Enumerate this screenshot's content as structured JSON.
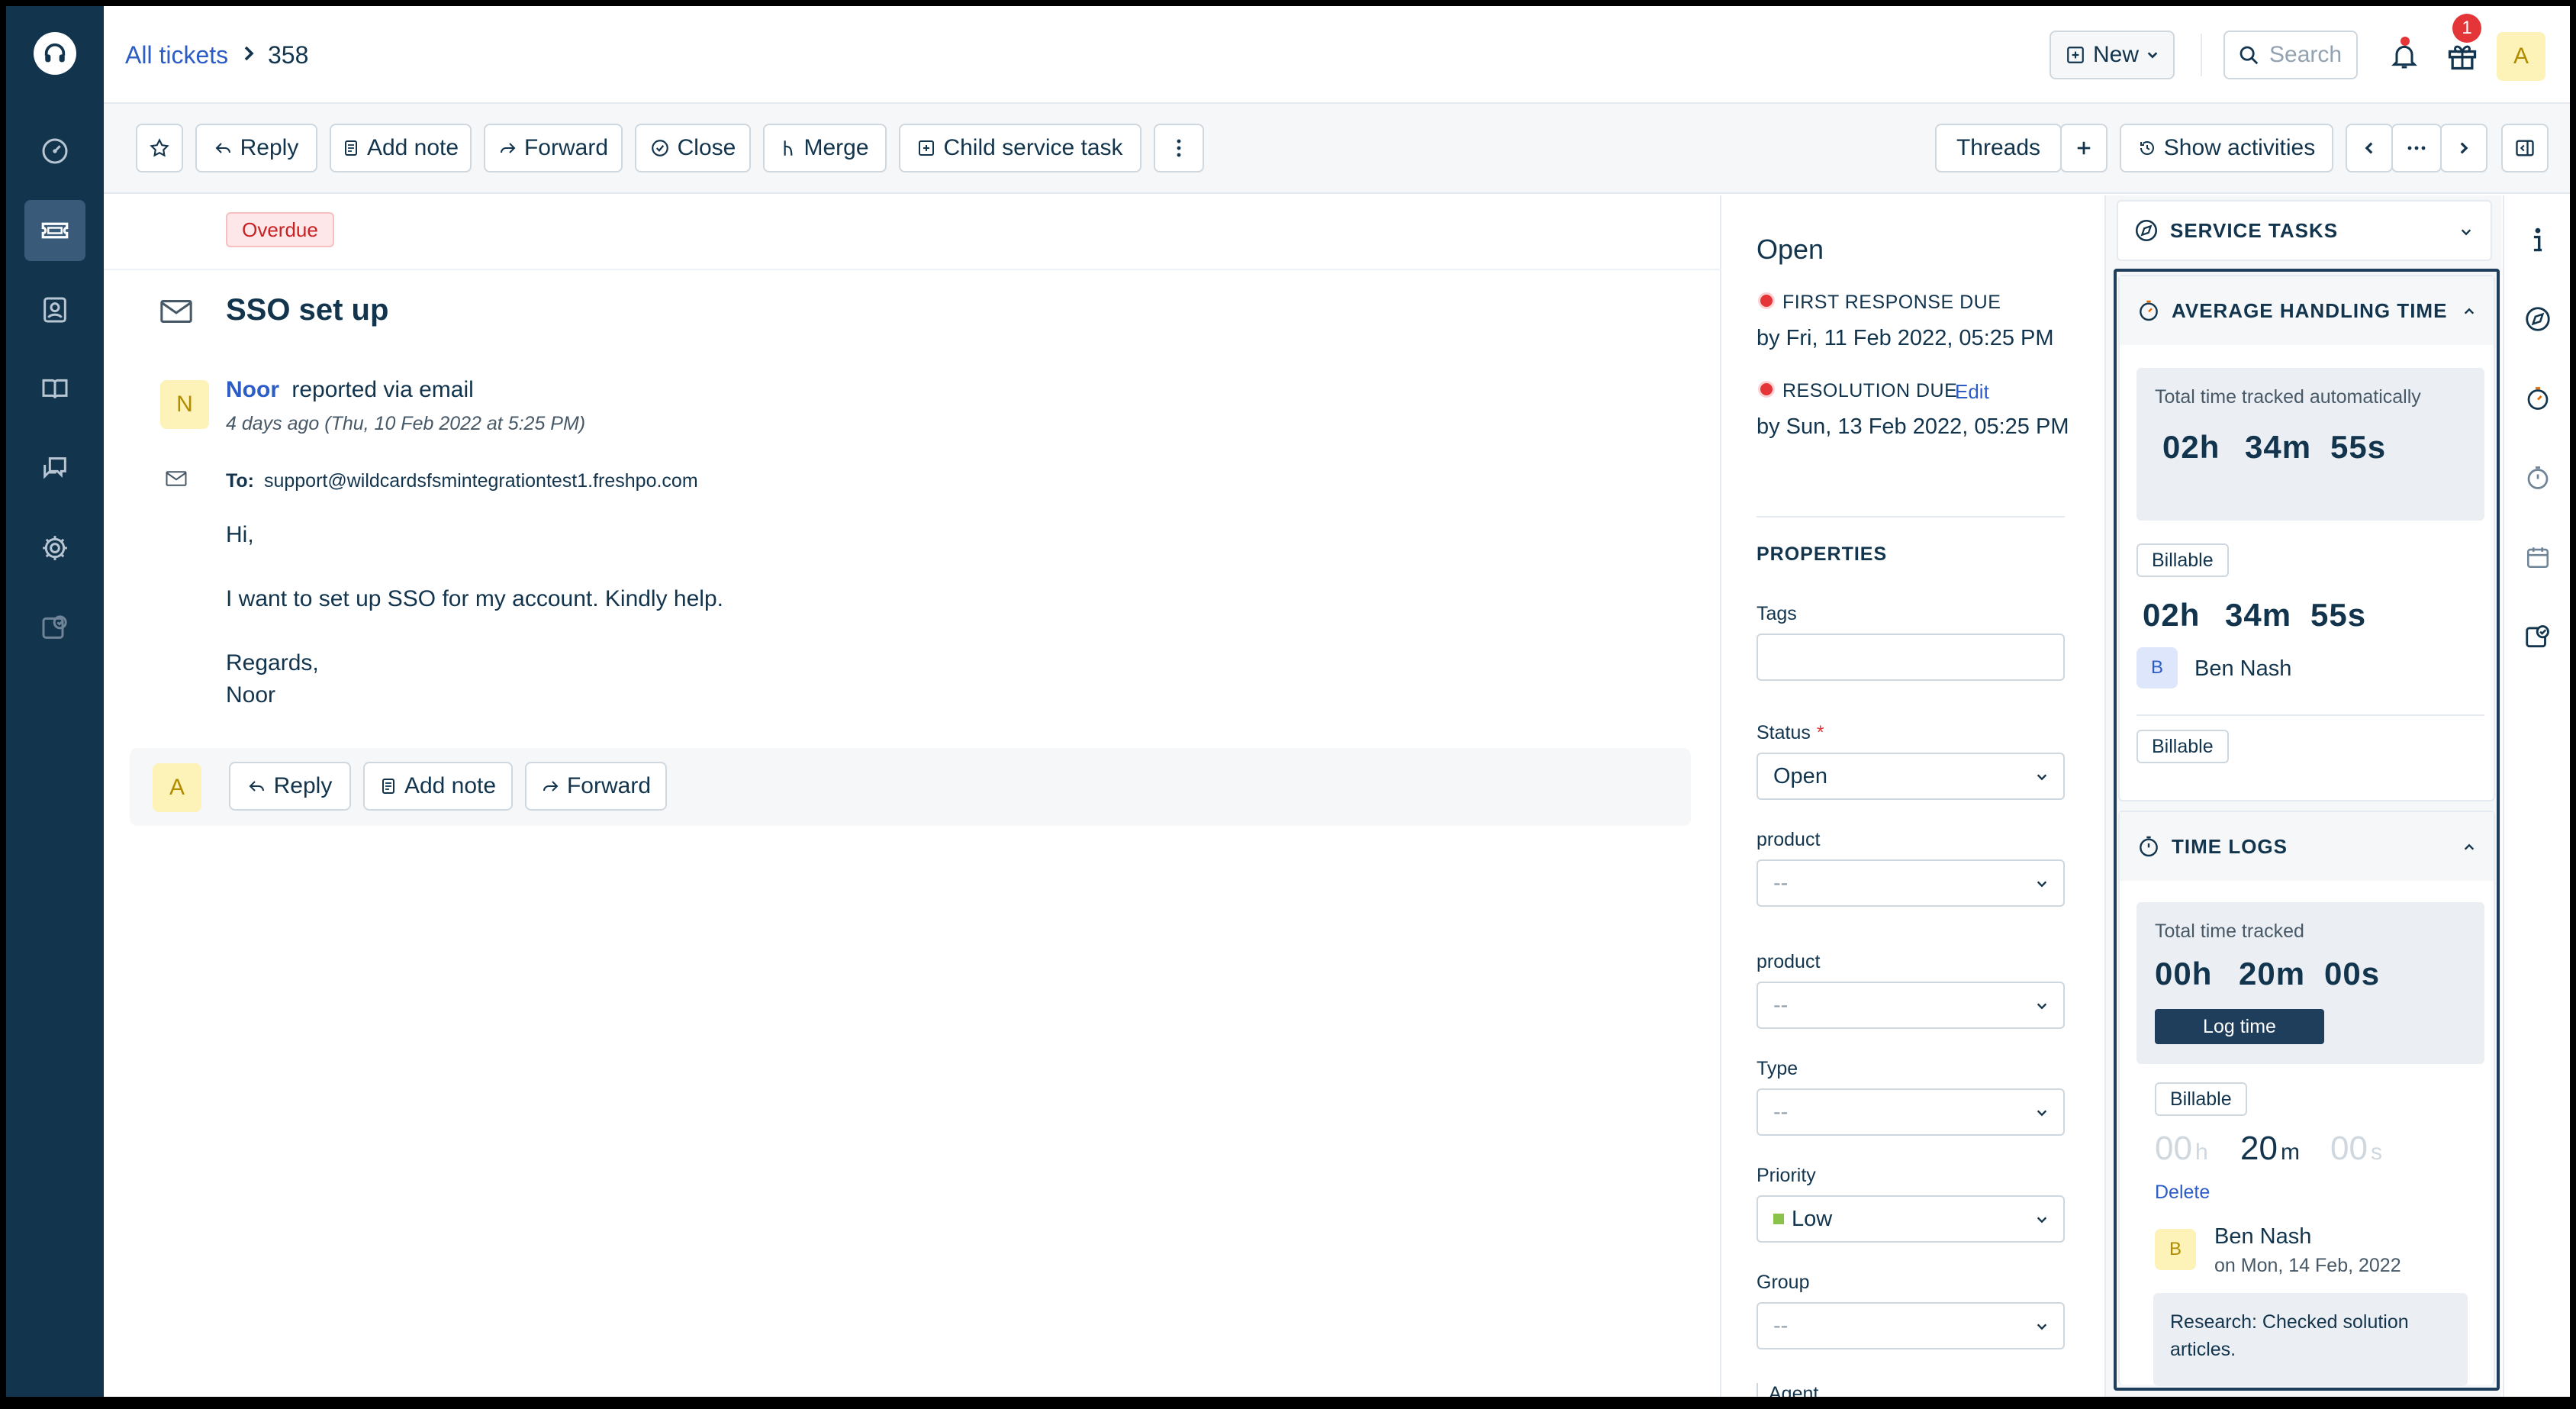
{
  "header": {
    "breadcrumb_root": "All tickets",
    "ticket_id": "358",
    "new_label": "New",
    "search_placeholder": "Search",
    "gift_badge": "1",
    "avatar_initial": "A"
  },
  "toolbar": {
    "reply": "Reply",
    "add_note": "Add note",
    "forward": "Forward",
    "close": "Close",
    "merge": "Merge",
    "child_task": "Child service task",
    "threads": "Threads",
    "show_activities": "Show activities"
  },
  "ticket": {
    "badge": "Overdue",
    "subject": "SSO set up",
    "requester_initial": "N",
    "requester": "Noor",
    "reported_via": "reported via email",
    "time": "4 days ago (Thu, 10 Feb 2022 at 5:25 PM)",
    "to_label": "To:",
    "to_address": "support@wildcardsfsmintegrationtest1.freshpo.com",
    "body": [
      "Hi,",
      "I want to set up SSO for my account. Kindly help.",
      "Regards,",
      "Noor"
    ],
    "reply_avatar": "A",
    "reply": "Reply",
    "add_note": "Add note",
    "forward": "Forward"
  },
  "properties": {
    "status_title": "Open",
    "first_response_label": "FIRST RESPONSE DUE",
    "first_response_value": "by Fri, 11 Feb 2022, 05:25 PM",
    "resolution_label": "RESOLUTION DUE",
    "resolution_edit": "Edit",
    "resolution_value": "by Sun, 13 Feb 2022, 05:25 PM",
    "heading": "PROPERTIES",
    "tags_label": "Tags",
    "status_label": "Status",
    "status_required": "*",
    "status_value": "Open",
    "product1_label": "product",
    "product1_value": "--",
    "product2_label": "product",
    "product2_value": "--",
    "type_label": "Type",
    "type_value": "--",
    "priority_label": "Priority",
    "priority_value": "Low",
    "group_label": "Group",
    "group_value": "--",
    "agent_label": "Agent"
  },
  "widgets": {
    "service_tasks": "SERVICE TASKS",
    "aht": {
      "title": "AVERAGE HANDLING TIME",
      "auto_label": "Total time tracked automatically",
      "auto_h": "02h",
      "auto_m": "34m",
      "auto_s": "55s",
      "billable1": "Billable",
      "bill_h": "02h",
      "bill_m": "34m",
      "bill_s": "55s",
      "user_initial": "B",
      "user_name": "Ben Nash",
      "billable2": "Billable"
    },
    "time_logs": {
      "title": "TIME LOGS",
      "total_label": "Total time tracked",
      "total_h": "00h",
      "total_m": "20m",
      "total_s": "00s",
      "log_time": "Log time",
      "billable": "Billable",
      "entry_h": "00",
      "entry_h_unit": "h",
      "entry_m": "20",
      "entry_m_unit": "m",
      "entry_s": "00",
      "entry_s_unit": "s",
      "delete": "Delete",
      "user_initial": "B",
      "user_name": "Ben Nash",
      "user_date": "on Mon, 14 Feb, 2022",
      "note": "Research: Checked solution articles."
    }
  },
  "colors": {
    "nav_bg": "#12344d",
    "accent": "#2c5cc5",
    "danger": "#e43538",
    "priority_low": "#8bc34a"
  }
}
